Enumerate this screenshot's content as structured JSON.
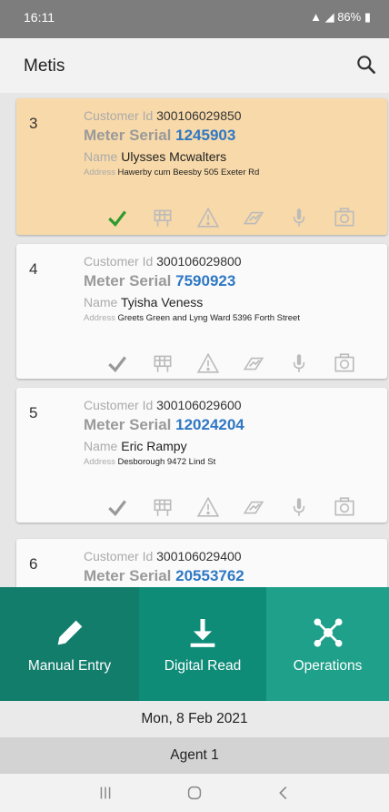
{
  "status": {
    "time": "16:11",
    "signal": "86%"
  },
  "app": {
    "title": "Metis",
    "search_icon": "search-icon"
  },
  "labels": {
    "customer_id": "Customer Id",
    "meter_serial": "Meter Serial",
    "name": "Name",
    "address": "Address"
  },
  "records": [
    {
      "num": "3",
      "customer_id": "300106029850",
      "meter_serial": "1245903",
      "name": "Ulysses Mcwalters",
      "address": "Hawerby cum Beesby 505 Exeter Rd"
    },
    {
      "num": "4",
      "customer_id": "300106029800",
      "meter_serial": "7590923",
      "name": "Tyisha Veness",
      "address": "Greets Green and Lyng Ward 5396 Forth Street"
    },
    {
      "num": "5",
      "customer_id": "300106029600",
      "meter_serial": "12024204",
      "name": "Eric Rampy",
      "address": "Desborough 9472 Lind St"
    },
    {
      "num": "6",
      "customer_id": "300106029400",
      "meter_serial": "20553762"
    }
  ],
  "action_icons": [
    "check-icon",
    "gate-icon",
    "warning-icon",
    "meter-icon",
    "microphone-icon",
    "camera-icon"
  ],
  "tabs": [
    {
      "label": "Manual Entry",
      "icon": "pencil-icon"
    },
    {
      "label": "Digital Read",
      "icon": "download-icon"
    },
    {
      "label": "Operations",
      "icon": "network-icon"
    }
  ],
  "footer": {
    "date": "Mon, 8 Feb 2021",
    "agent": "Agent 1"
  },
  "colors": {
    "selected_card": "#f8d9a9",
    "accent_green": "#2f9a2f",
    "tab_dark": "#137d6c",
    "tab_mid": "#0e8c78",
    "tab_light": "#1fa08a",
    "serial_blue": "#2f78c4"
  }
}
